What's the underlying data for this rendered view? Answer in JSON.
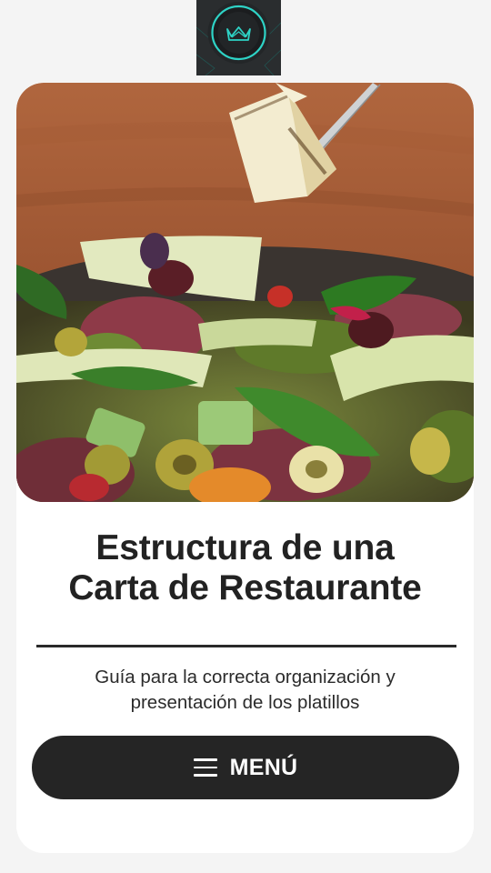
{
  "header": {
    "logo_icon": "crown-icon"
  },
  "hero": {
    "image_subject": "salad-bowl-image"
  },
  "content": {
    "title_line1": "Estructura de una",
    "title_line2": "Carta de Restaurante",
    "subtitle_line1": "Guía para la correcta organización y",
    "subtitle_line2": "presentación de los platillos"
  },
  "menu_button": {
    "icon": "hamburger-menu-icon",
    "label": "MENÚ"
  },
  "colors": {
    "page_background": "#f4f4f4",
    "card_background": "#ffffff",
    "button_background": "#252525",
    "text_dark": "#222222",
    "logo_background": "#2a2d2f",
    "logo_accent": "#2ed3c6"
  }
}
